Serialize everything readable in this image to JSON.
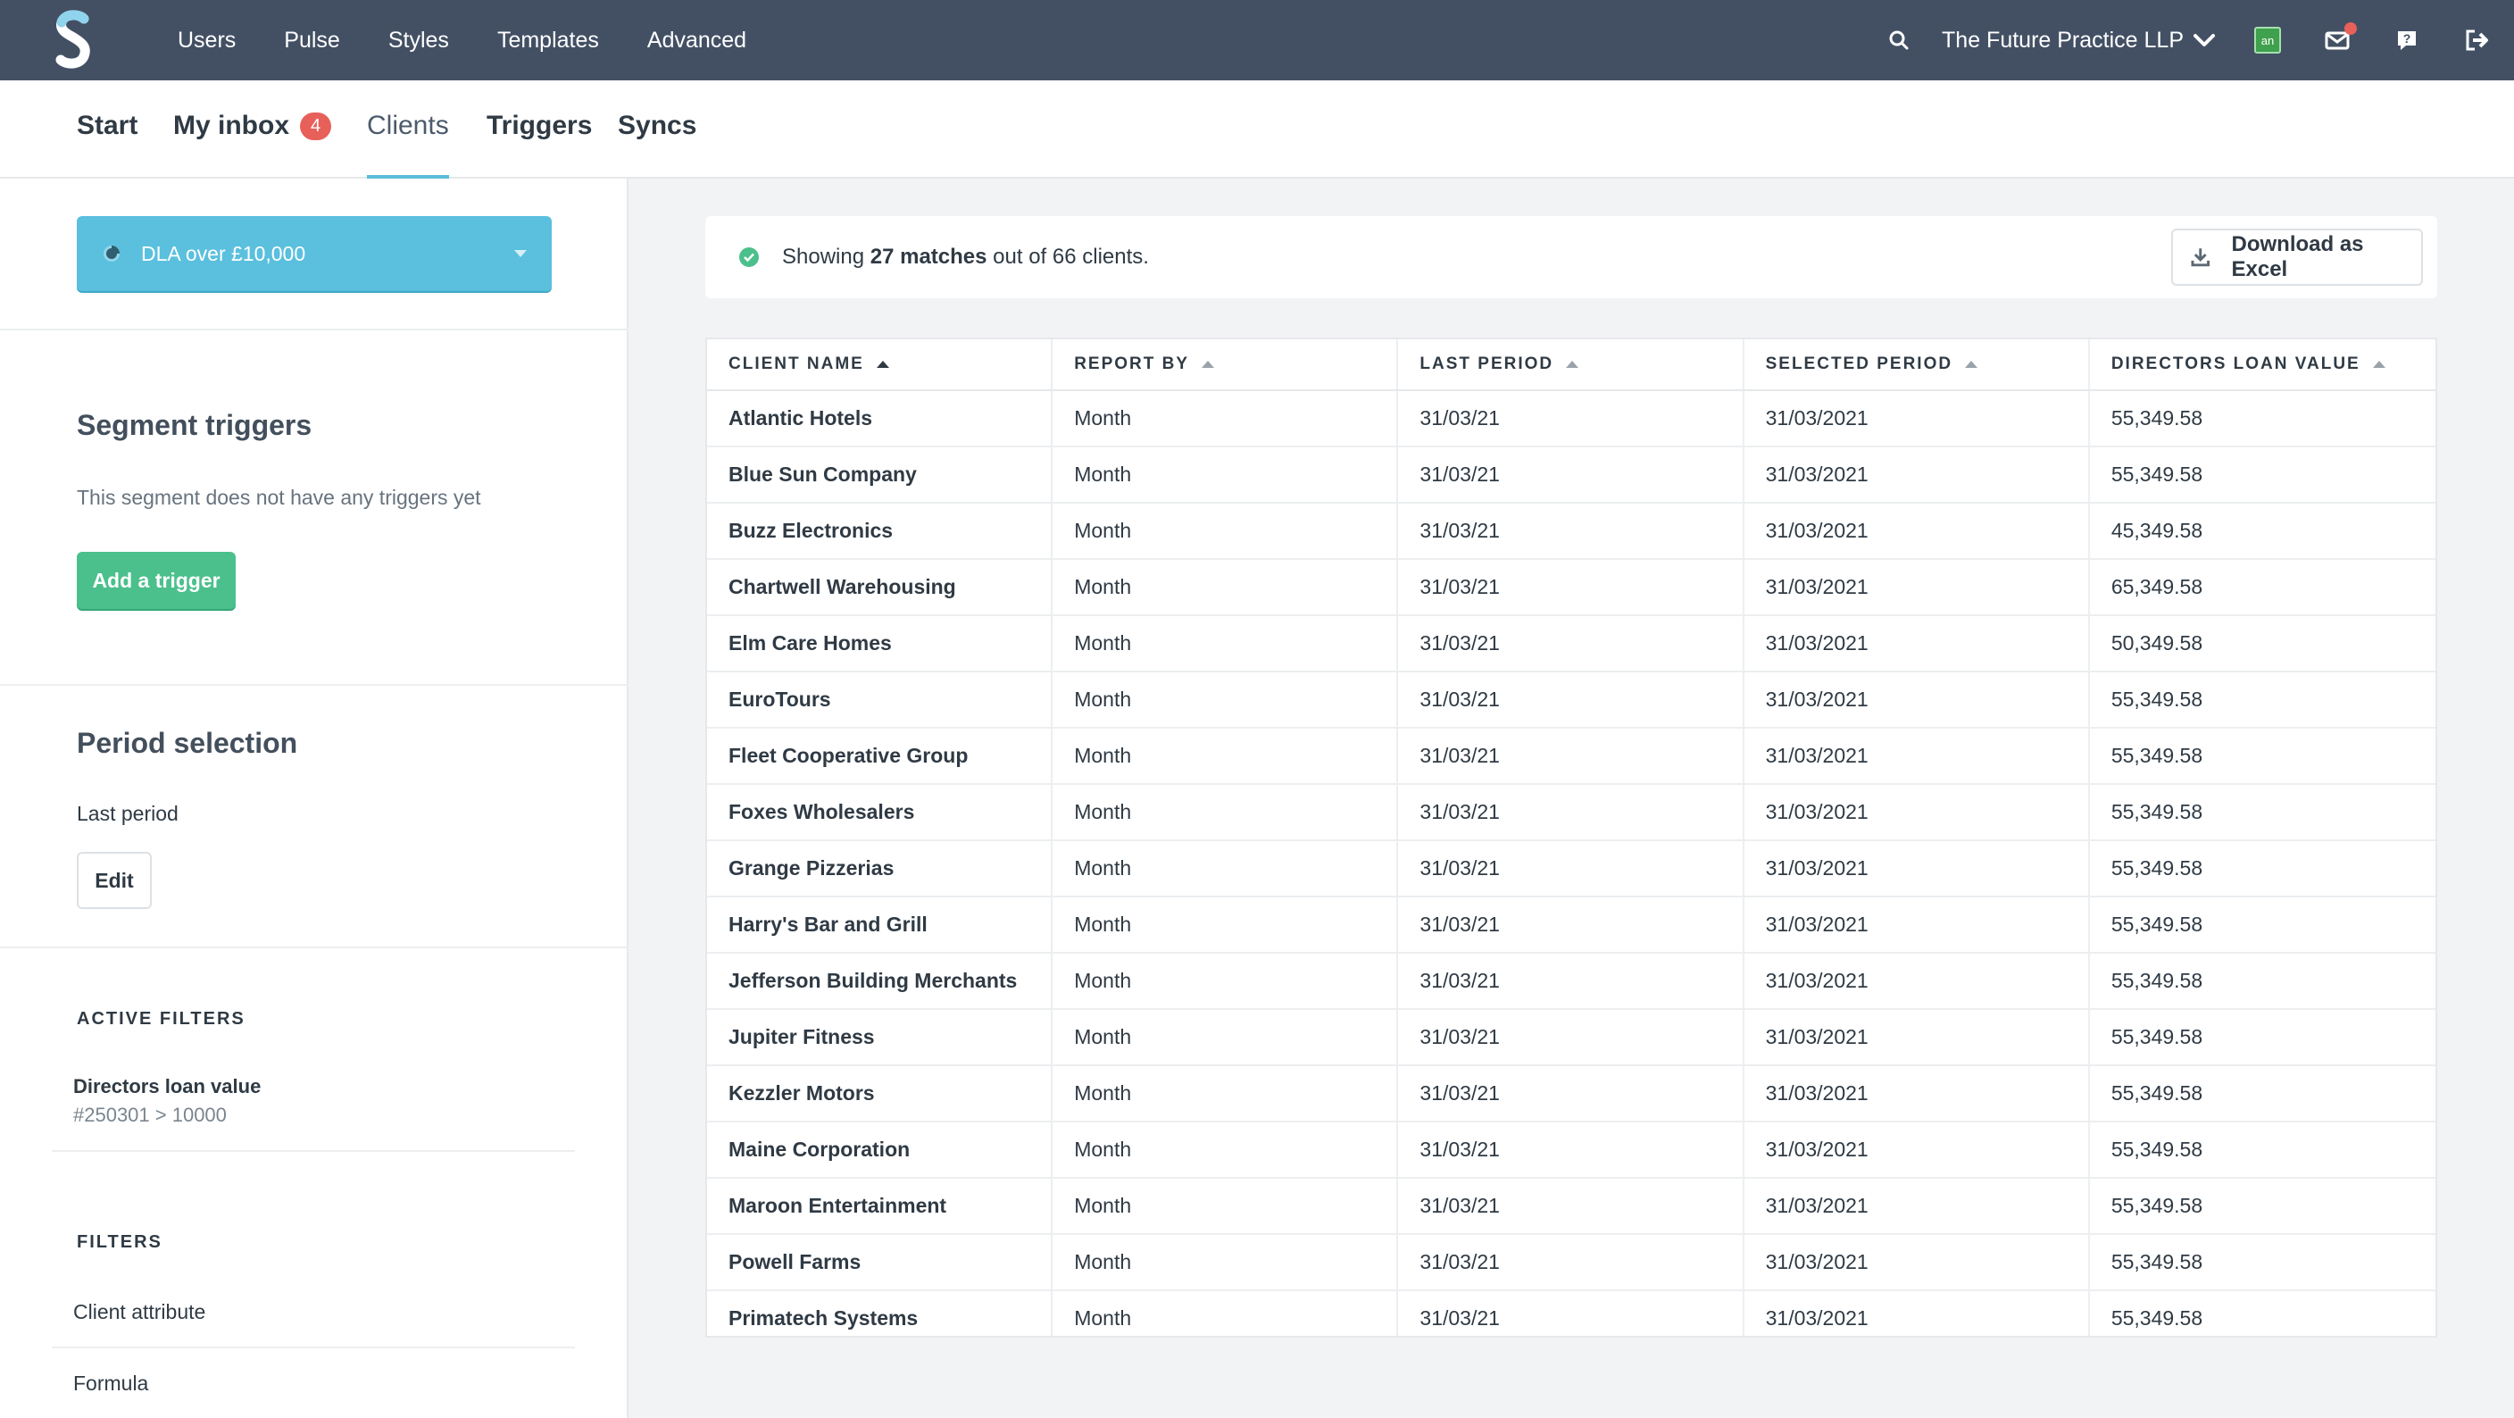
{
  "topnav": {
    "logo_letter": "S",
    "items": [
      "Users",
      "Pulse",
      "Styles",
      "Templates",
      "Advanced"
    ],
    "organisation": "The Future Practice LLP",
    "app_icon_label": "an",
    "icons": [
      "search-icon",
      "chevron-down-icon",
      "app-icon",
      "mail-icon",
      "help-icon",
      "logout-icon"
    ],
    "notification_dot_color": "#e8605a"
  },
  "tabs": {
    "start": "Start",
    "inbox": "My inbox",
    "inbox_count": "4",
    "clients": "Clients",
    "triggers": "Triggers",
    "syncs": "Syncs",
    "active": "Clients",
    "accent_color": "#5bbcd9"
  },
  "sidebar": {
    "segment": "DLA over £10,000",
    "segment_color": "#5ac0de",
    "segment_triggers_title": "Segment triggers",
    "no_triggers_text": "This segment does not have any triggers yet",
    "add_trigger_label": "Add a trigger",
    "period_selection_title": "Period selection",
    "period_value": "Last period",
    "edit_label": "Edit",
    "active_filters_title": "ACTIVE FILTERS",
    "active_filter_name": "Directors loan value",
    "active_filter_expr": "#250301 > 10000",
    "filters_title": "FILTERS",
    "filter_client_attribute": "Client attribute",
    "filter_formula": "Formula"
  },
  "summary": {
    "prefix": "Showing",
    "matches": "27 matches",
    "suffix": "out of 66 clients.",
    "download_label": "Download as Excel"
  },
  "table": {
    "columns": [
      "CLIENT NAME",
      "REPORT BY",
      "LAST PERIOD",
      "SELECTED PERIOD",
      "DIRECTORS LOAN VALUE"
    ],
    "sorted_column": "CLIENT NAME",
    "rows": [
      [
        "Atlantic Hotels",
        "Month",
        "31/03/21",
        "31/03/2021",
        "55,349.58"
      ],
      [
        "Blue Sun Company",
        "Month",
        "31/03/21",
        "31/03/2021",
        "55,349.58"
      ],
      [
        "Buzz Electronics",
        "Month",
        "31/03/21",
        "31/03/2021",
        "45,349.58"
      ],
      [
        "Chartwell Warehousing",
        "Month",
        "31/03/21",
        "31/03/2021",
        "65,349.58"
      ],
      [
        "Elm Care Homes",
        "Month",
        "31/03/21",
        "31/03/2021",
        "50,349.58"
      ],
      [
        "EuroTours",
        "Month",
        "31/03/21",
        "31/03/2021",
        "55,349.58"
      ],
      [
        "Fleet Cooperative Group",
        "Month",
        "31/03/21",
        "31/03/2021",
        "55,349.58"
      ],
      [
        "Foxes Wholesalers",
        "Month",
        "31/03/21",
        "31/03/2021",
        "55,349.58"
      ],
      [
        "Grange Pizzerias",
        "Month",
        "31/03/21",
        "31/03/2021",
        "55,349.58"
      ],
      [
        "Harry's Bar and Grill",
        "Month",
        "31/03/21",
        "31/03/2021",
        "55,349.58"
      ],
      [
        "Jefferson Building Merchants",
        "Month",
        "31/03/21",
        "31/03/2021",
        "55,349.58"
      ],
      [
        "Jupiter Fitness",
        "Month",
        "31/03/21",
        "31/03/2021",
        "55,349.58"
      ],
      [
        "Kezzler Motors",
        "Month",
        "31/03/21",
        "31/03/2021",
        "55,349.58"
      ],
      [
        "Maine Corporation",
        "Month",
        "31/03/21",
        "31/03/2021",
        "55,349.58"
      ],
      [
        "Maroon Entertainment",
        "Month",
        "31/03/21",
        "31/03/2021",
        "55,349.58"
      ],
      [
        "Powell Farms",
        "Month",
        "31/03/21",
        "31/03/2021",
        "55,349.58"
      ],
      [
        "Primatech Systems",
        "Month",
        "31/03/21",
        "31/03/2021",
        "55,349.58"
      ]
    ]
  }
}
